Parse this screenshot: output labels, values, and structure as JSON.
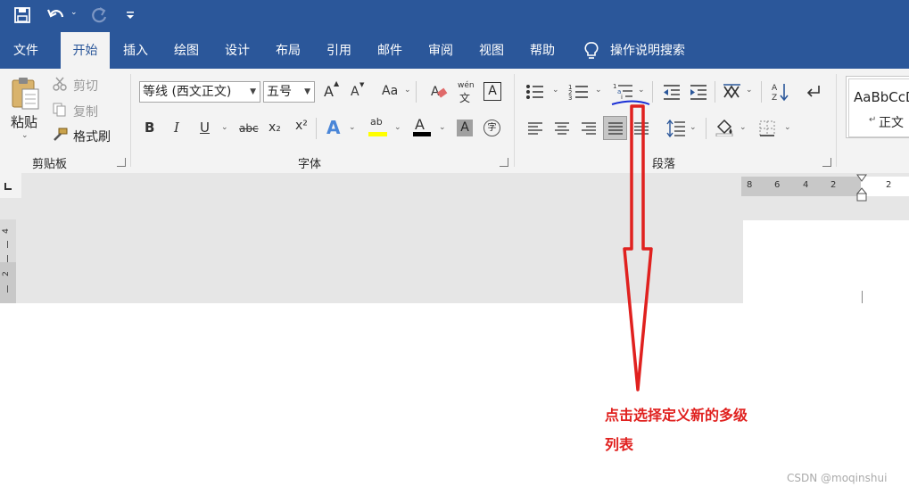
{
  "quick_access": {
    "save_icon": "save-icon",
    "undo_icon": "undo-icon",
    "redo_icon": "redo-icon",
    "customize_icon": "customize-icon"
  },
  "tabs": [
    "文件",
    "开始",
    "插入",
    "绘图",
    "设计",
    "布局",
    "引用",
    "邮件",
    "审阅",
    "视图",
    "帮助"
  ],
  "active_tab": "开始",
  "tell_me": "操作说明搜索",
  "clipboard": {
    "paste": "粘贴",
    "cut": "剪切",
    "copy": "复制",
    "format_painter": "格式刷",
    "label": "剪贴板"
  },
  "font": {
    "family": "等线 (西文正文)",
    "size": "五号",
    "label": "字体",
    "grow": "A",
    "shrink": "A",
    "change_case": "Aa",
    "bold": "B",
    "italic": "I",
    "underline": "U",
    "strike": "abc",
    "subscript": "x₂",
    "superscript": "x²",
    "pinyin_top": "wén",
    "pinyin_bottom": "文",
    "char_border": "A",
    "char_shade": "A",
    "enclose": "字",
    "highlight": "ab",
    "color": "A"
  },
  "paragraph": {
    "label": "段落"
  },
  "styles": {
    "preview": "AaBbCcD",
    "name": "正文"
  },
  "ruler": {
    "h_ticks": [
      "8",
      "6",
      "4",
      "2",
      "2"
    ],
    "v_ticks": [
      "4",
      "2"
    ]
  },
  "annotation": {
    "line1": "点击选择定义新的多级",
    "line2": "列表"
  },
  "watermark": "CSDN @moqinshui",
  "colors": {
    "title_bar": "#2b579a",
    "accent": "#2b579a",
    "highlight": "#ffff00",
    "font_color": "#000000",
    "annotation": "#e0211f",
    "underline_mark": "#1a2fd6"
  }
}
